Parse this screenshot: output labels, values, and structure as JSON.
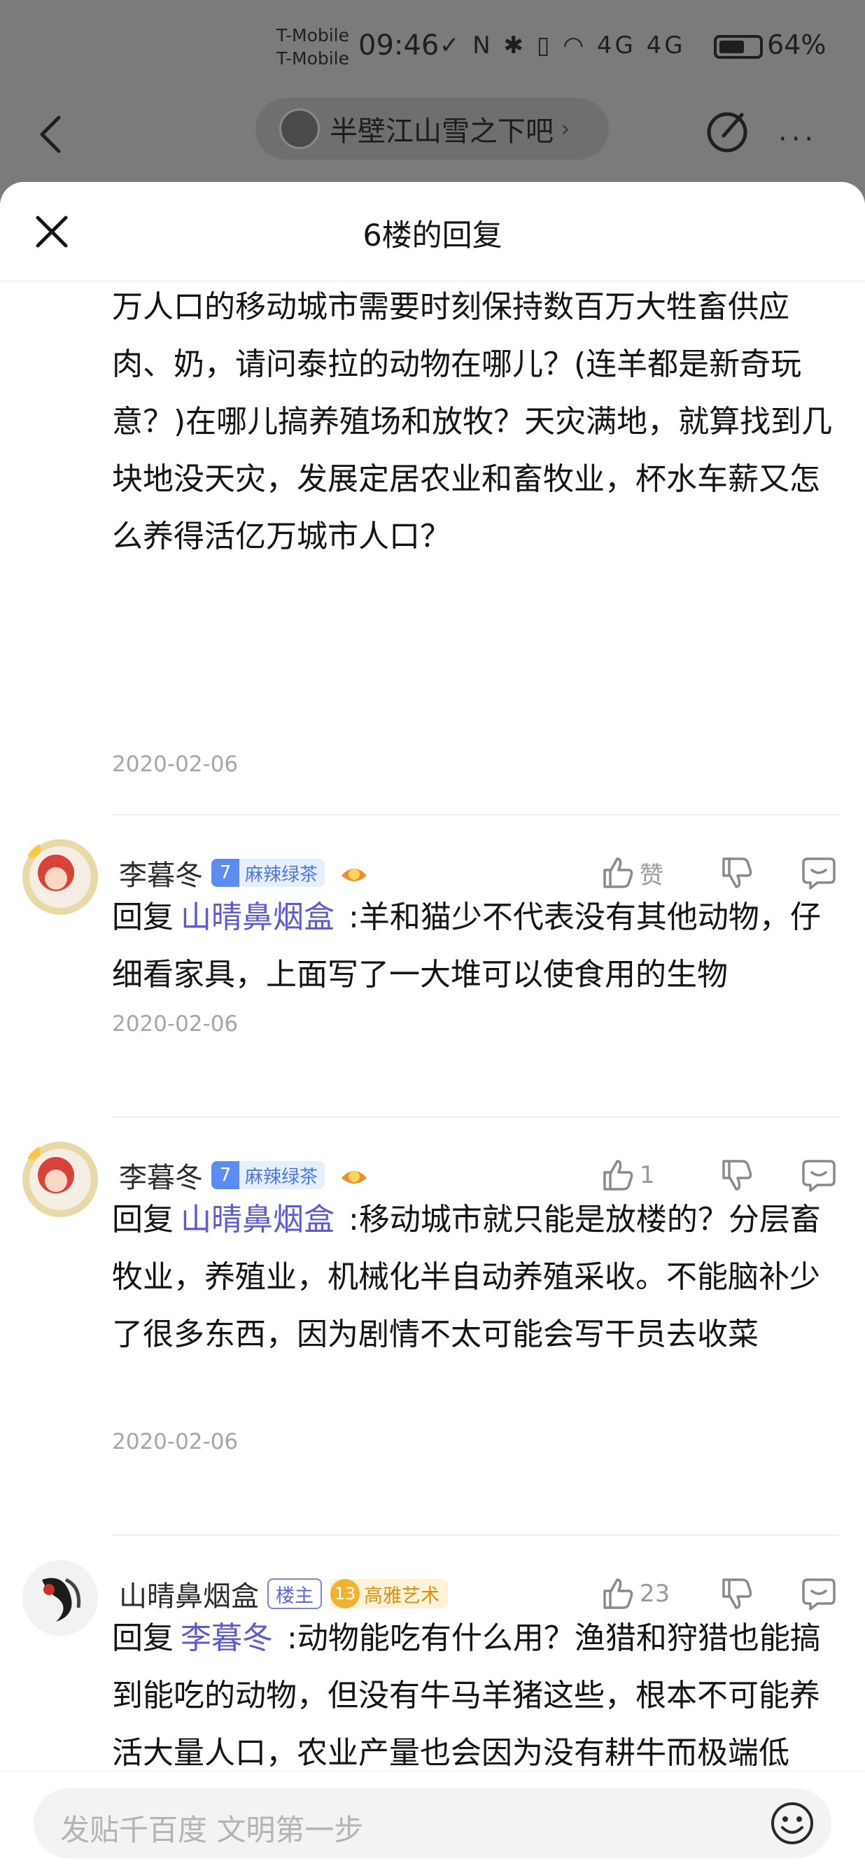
{
  "status": {
    "carrier1": "T-Mobile",
    "carrier2": "T-Mobile",
    "time": "09:46",
    "battery_pct": "64%",
    "battery_level": 0.64,
    "icons": "✓ N ✱ ▯ ◠ 4G 4G"
  },
  "nav": {
    "forum_name": "半壁江山雪之下吧",
    "chevron": "›",
    "more": "···"
  },
  "sheet": {
    "title": "6楼的回复"
  },
  "continued": {
    "text": "万人口的移动城市需要时刻保持数百万大牲畜供应肉、奶，请问泰拉的动物在哪儿？(连羊都是新奇玩意？)在哪儿搞养殖场和放牧？天灾满地，就算找到几块地没天灾，发展定居农业和畜牧业，杯水车薪又怎么养得活亿万城市人口？",
    "date": "2020-02-06"
  },
  "replies": [
    {
      "username": "李暮冬",
      "level": "7",
      "badge": "麻辣绿茶",
      "likes": "赞",
      "reply_prefix": "回复",
      "reply_to": "山晴鼻烟盒",
      "text": ":羊和猫少不代表没有其他动物，仔细看家具，上面写了一大堆可以使食用的生物",
      "date": "2020-02-06"
    },
    {
      "username": "李暮冬",
      "level": "7",
      "badge": "麻辣绿茶",
      "likes": "1",
      "reply_prefix": "回复",
      "reply_to": "山晴鼻烟盒",
      "text": ":移动城市就只能是放楼的？分层畜牧业，养殖业，机械化半自动养殖采收。不能脑补少了很多东西，因为剧情不太可能会写干员去收菜",
      "date": "2020-02-06"
    },
    {
      "username": "山晴鼻烟盒",
      "owner_badge": "楼主",
      "level": "13",
      "badge": "高雅艺术",
      "likes": "23",
      "reply_prefix": "回复",
      "reply_to": "李暮冬",
      "text": ":动物能吃有什么用？渔猎和狩猎也能搞到能吃的动物，但没有牛马羊猪这些，根本不可能养活大量人口，农业产量也会因为没有耕牛而极端低下。无土栽培？首先靠那点栽培能养活几个人，而且为什么他们会掌握这玩意？史前文明？为什么"
    }
  ],
  "input": {
    "placeholder": "发贴千百度 文明第一步"
  },
  "colors": {
    "link": "#5e5ad6",
    "level_badge": "#5b8cf2",
    "gold_badge": "#f2b230",
    "owner_badge": "#7b82e7"
  }
}
